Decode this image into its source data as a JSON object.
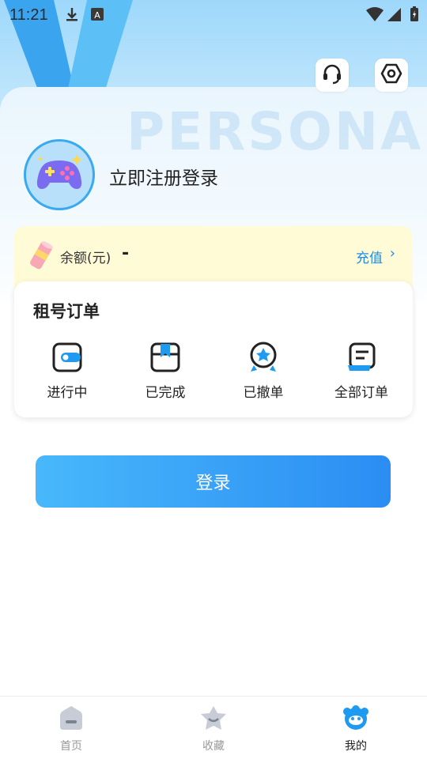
{
  "status_bar": {
    "time": "11:21",
    "icons": [
      "download-icon",
      "a-icon",
      "wifi-icon",
      "signal-icon",
      "battery-icon"
    ]
  },
  "header": {
    "watermark": "PERSONAL",
    "support_icon": "headset-icon",
    "settings_icon": "hexagon-settings-icon"
  },
  "profile": {
    "login_prompt": "立即注册登录",
    "avatar_icon": "gamepad-icon"
  },
  "balance": {
    "label": "余额(元)",
    "value": "-",
    "recharge_label": "充值",
    "recharge_arrow": "›"
  },
  "orders": {
    "title": "租号订单",
    "items": [
      {
        "label": "进行中",
        "icon": "in-progress-icon"
      },
      {
        "label": "已完成",
        "icon": "completed-icon"
      },
      {
        "label": "已撤单",
        "icon": "cancelled-icon"
      },
      {
        "label": "全部订单",
        "icon": "all-orders-icon"
      }
    ]
  },
  "login_button": "登录",
  "tabbar": {
    "items": [
      {
        "label": "首页",
        "icon": "home-icon",
        "active": false
      },
      {
        "label": "收藏",
        "icon": "favorite-icon",
        "active": false
      },
      {
        "label": "我的",
        "icon": "profile-icon",
        "active": true
      }
    ]
  },
  "colors": {
    "accent": "#2b8df3",
    "accent_light": "#48b8fb",
    "balance_bg": "#fefbd6",
    "recharge": "#1b8ef0"
  }
}
